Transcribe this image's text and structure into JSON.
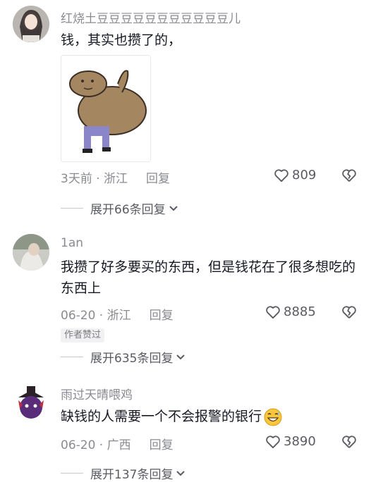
{
  "comments": [
    {
      "username": "红烧土豆豆豆豆豆豆豆豆豆豆豆儿",
      "text": "钱，其实也攒了的，",
      "time": "3天前",
      "location": "浙江",
      "reply_label": "回复",
      "likes": "809",
      "expand_label": "展开66条回复"
    },
    {
      "username": "1an",
      "text": "我攒了好多要买的东西，但是钱花在了很多想吃的东西上",
      "time": "06-20",
      "location": "浙江",
      "reply_label": "回复",
      "likes": "8885",
      "badge": "作者赞过",
      "expand_label": "展开635条回复"
    },
    {
      "username": "雨过天晴喂鸡",
      "text": "缺钱的人需要一个不会报警的银行",
      "time": "06-20",
      "location": "广西",
      "reply_label": "回复",
      "likes": "3890",
      "expand_label": "展开137条回复"
    }
  ],
  "separator": " · ",
  "icons": [
    "heart-icon",
    "broken-heart-icon",
    "chevron-down-icon",
    "grin-emoji-icon",
    "capybara-sticker"
  ]
}
